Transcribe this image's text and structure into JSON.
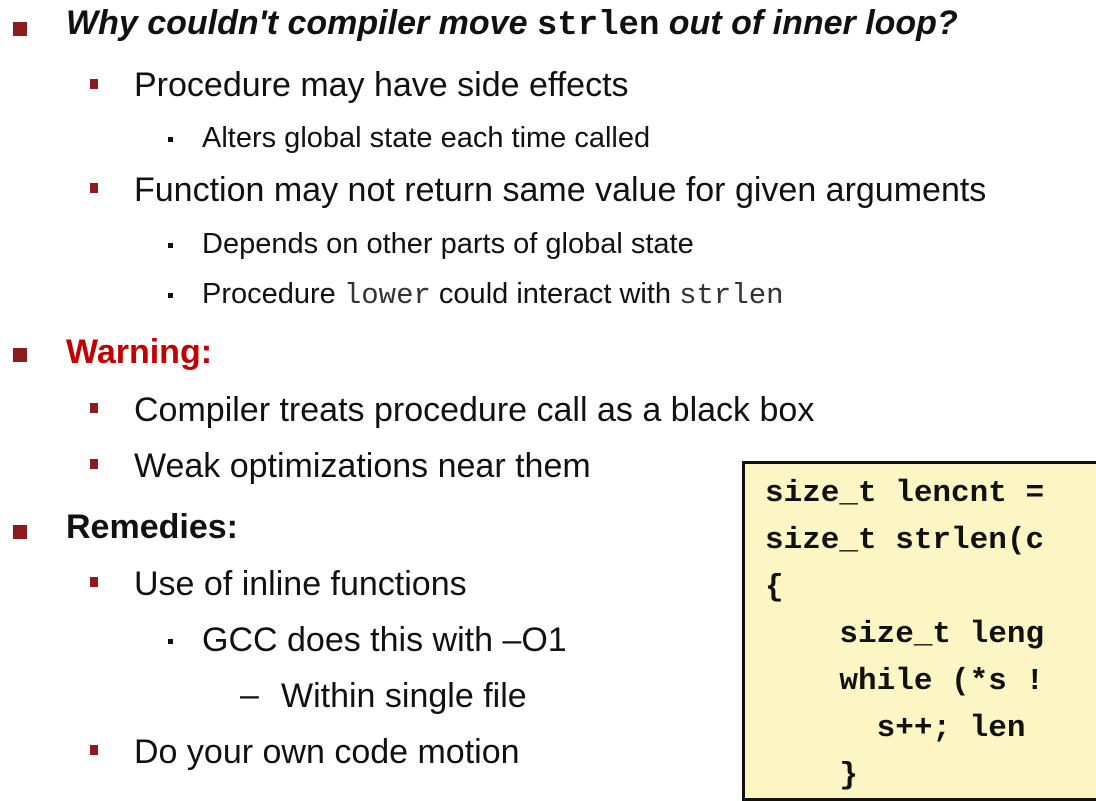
{
  "heading": {
    "before": "Why couldn't compiler move ",
    "code": "strlen",
    "after": " out of  inner loop?"
  },
  "side_effects": "Procedure may have side effects",
  "alters_state": "Alters global state each time called",
  "not_same_value": "Function may not return same value for given arguments",
  "depends_on": "Depends on other parts of global state",
  "interact": {
    "before": "Procedure ",
    "code1": "lower",
    "middle": " could interact with ",
    "code2": "strlen"
  },
  "warning": {
    "title": "Warning:",
    "items": [
      "Compiler treats procedure call as a black box",
      "Weak optimizations near them"
    ]
  },
  "remedies": {
    "title": "Remedies:",
    "inline": "Use of inline functions",
    "gcc": "GCC does this with –O1",
    "single_file": "Within single file",
    "code_motion": "Do your own code motion"
  },
  "code_lines": [
    "size_t lencnt =",
    "size_t strlen(c",
    "{",
    "    size_t leng",
    "    while (*s !",
    "      s++; len",
    "    }"
  ]
}
